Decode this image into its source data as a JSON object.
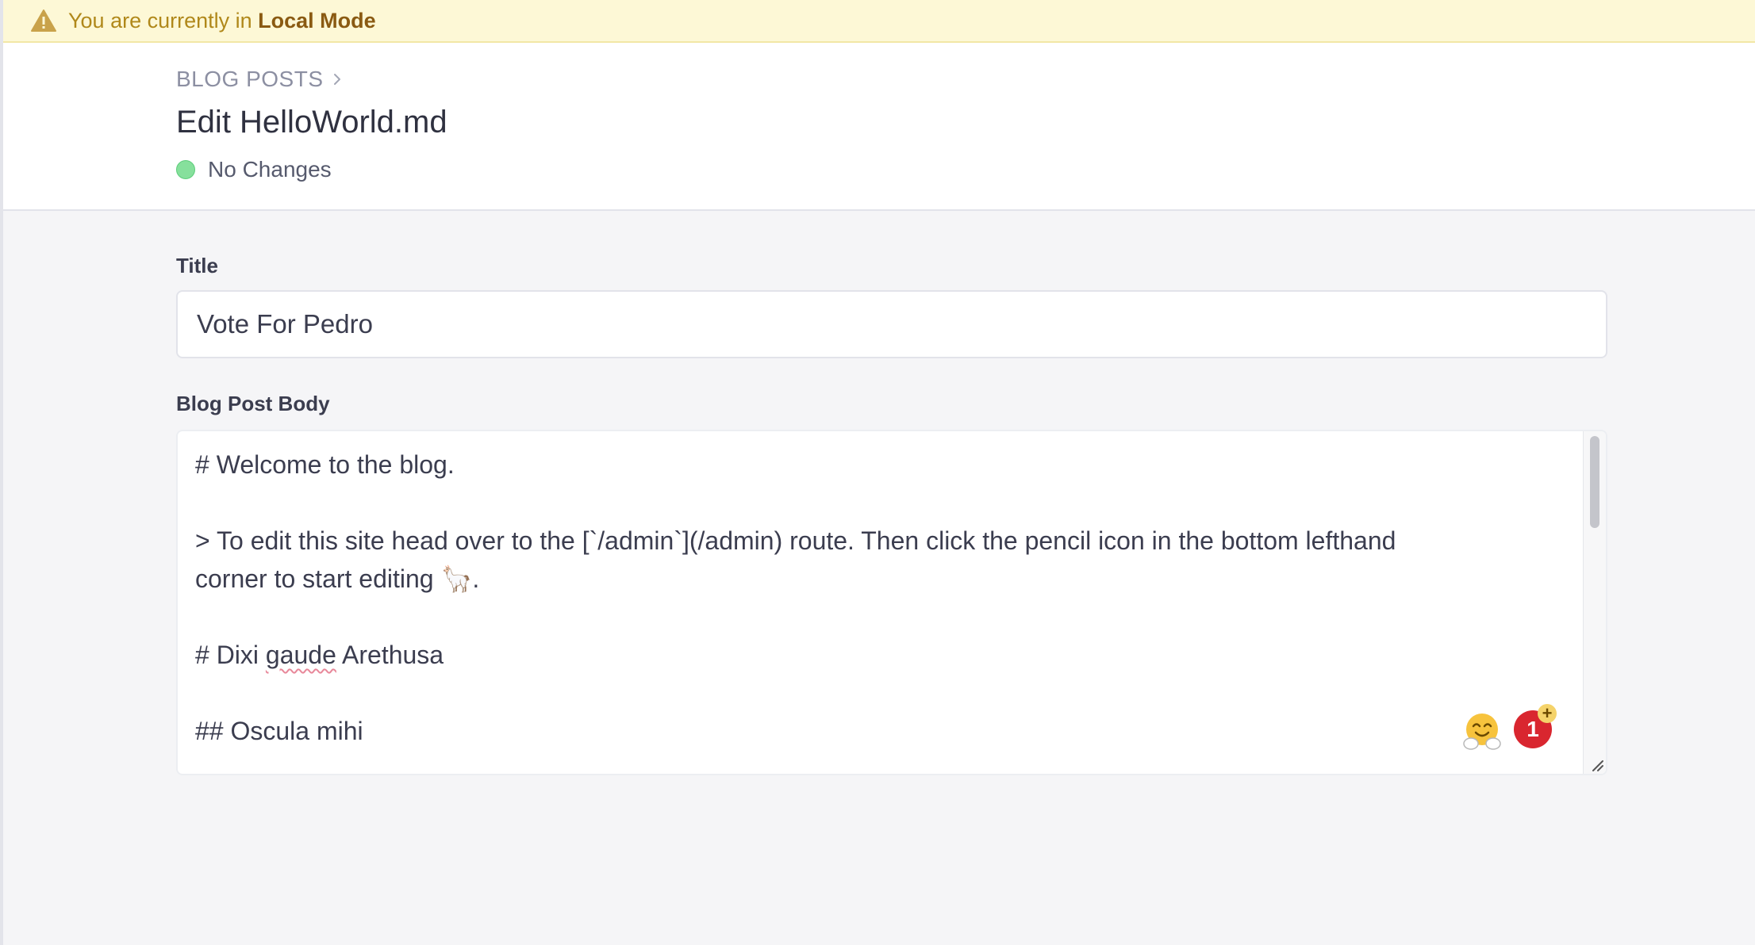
{
  "banner": {
    "prefix": "You are currently in",
    "mode": "Local Mode",
    "icon": "warning-icon"
  },
  "header": {
    "breadcrumb": "BLOG POSTS",
    "title": "Edit HelloWorld.md",
    "status": "No Changes",
    "status_color": "#86e09c"
  },
  "form": {
    "title_label": "Title",
    "title_value": "Vote For Pedro",
    "body_label": "Blog Post Body",
    "body_lines": {
      "l1": "# Welcome to the blog.",
      "l2": "> To edit this site head over to the [`/admin`](/admin) route. Then click the pencil icon in the bottom lefthand",
      "l3": "corner to start editing 🦙.",
      "l4_a": "# Dixi ",
      "l4_b": "gaude",
      "l4_c": " Arethusa",
      "l5": "## Oscula mihi"
    }
  },
  "widgets": {
    "notification_count": "1",
    "notification_plus": "+"
  },
  "colors": {
    "banner_bg": "#fdf8d6",
    "badge": "#d9262f"
  }
}
